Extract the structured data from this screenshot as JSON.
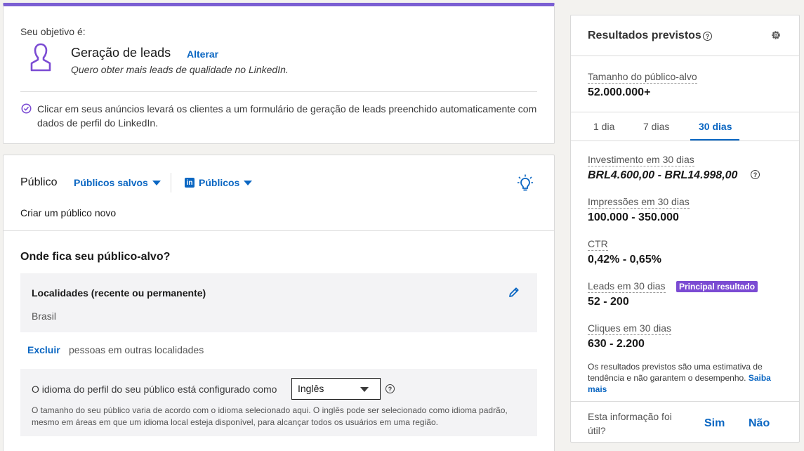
{
  "objective": {
    "label": "Seu objetivo é:",
    "title": "Geração de leads",
    "change_link": "Alterar",
    "description": "Quero obter mais leads de qualidade no LinkedIn.",
    "info": "Clicar em seus anúncios levará os clientes a um formulário de geração de leads preenchido automaticamente com dados de perfil do LinkedIn.",
    "accent_color": "#7b5fd3"
  },
  "audience": {
    "title": "Público",
    "saved_audiences": "Públicos salvos",
    "linkedin_audiences": "Públicos",
    "linkedin_logo": "in",
    "create_new": "Criar um público novo",
    "where_title": "Onde fica seu público-alvo?",
    "locations_title": "Localidades (recente ou permanente)",
    "locations_value": "Brasil",
    "exclude_button": "Excluir",
    "exclude_text": "pessoas em outras localidades",
    "language_label": "O idioma do perfil do seu público está configurado como",
    "language_selected": "Inglês",
    "language_note": "O tamanho do seu público varia de acordo com o idioma selecionado aqui. O inglês pode ser selecionado como idioma padrão, mesmo em áreas em que um idioma local esteja disponível, para alcançar todos os usuários em uma região."
  },
  "results": {
    "title": "Resultados previstos",
    "audience_size_label": "Tamanho do público-alvo",
    "audience_size_value": "52.000.000+",
    "tabs": [
      "1 dia",
      "7 dias",
      "30 dias"
    ],
    "active_tab": "30 dias",
    "investment_label": "Investimento em 30 dias",
    "investment_value": "BRL4.600,00 - BRL14.998,00",
    "impressions_label": "Impressões em 30 dias",
    "impressions_value": "100.000 - 350.000",
    "ctr_label": "CTR",
    "ctr_value": "0,42% - 0,65%",
    "leads_label": "Leads em 30 dias",
    "leads_badge": "Principal resultado",
    "leads_value": "52 - 200",
    "clicks_label": "Cliques em 30 dias",
    "clicks_value": "630 - 2.200",
    "disclaimer": "Os resultados previstos são uma estimativa de tendência e não garantem o desempenho.",
    "learn_more": "Saiba mais",
    "useful_question": "Esta informação foi útil?",
    "yes": "Sim",
    "no": "Não",
    "link_color": "#0a66c2",
    "badge_color": "#7b4bd3"
  }
}
